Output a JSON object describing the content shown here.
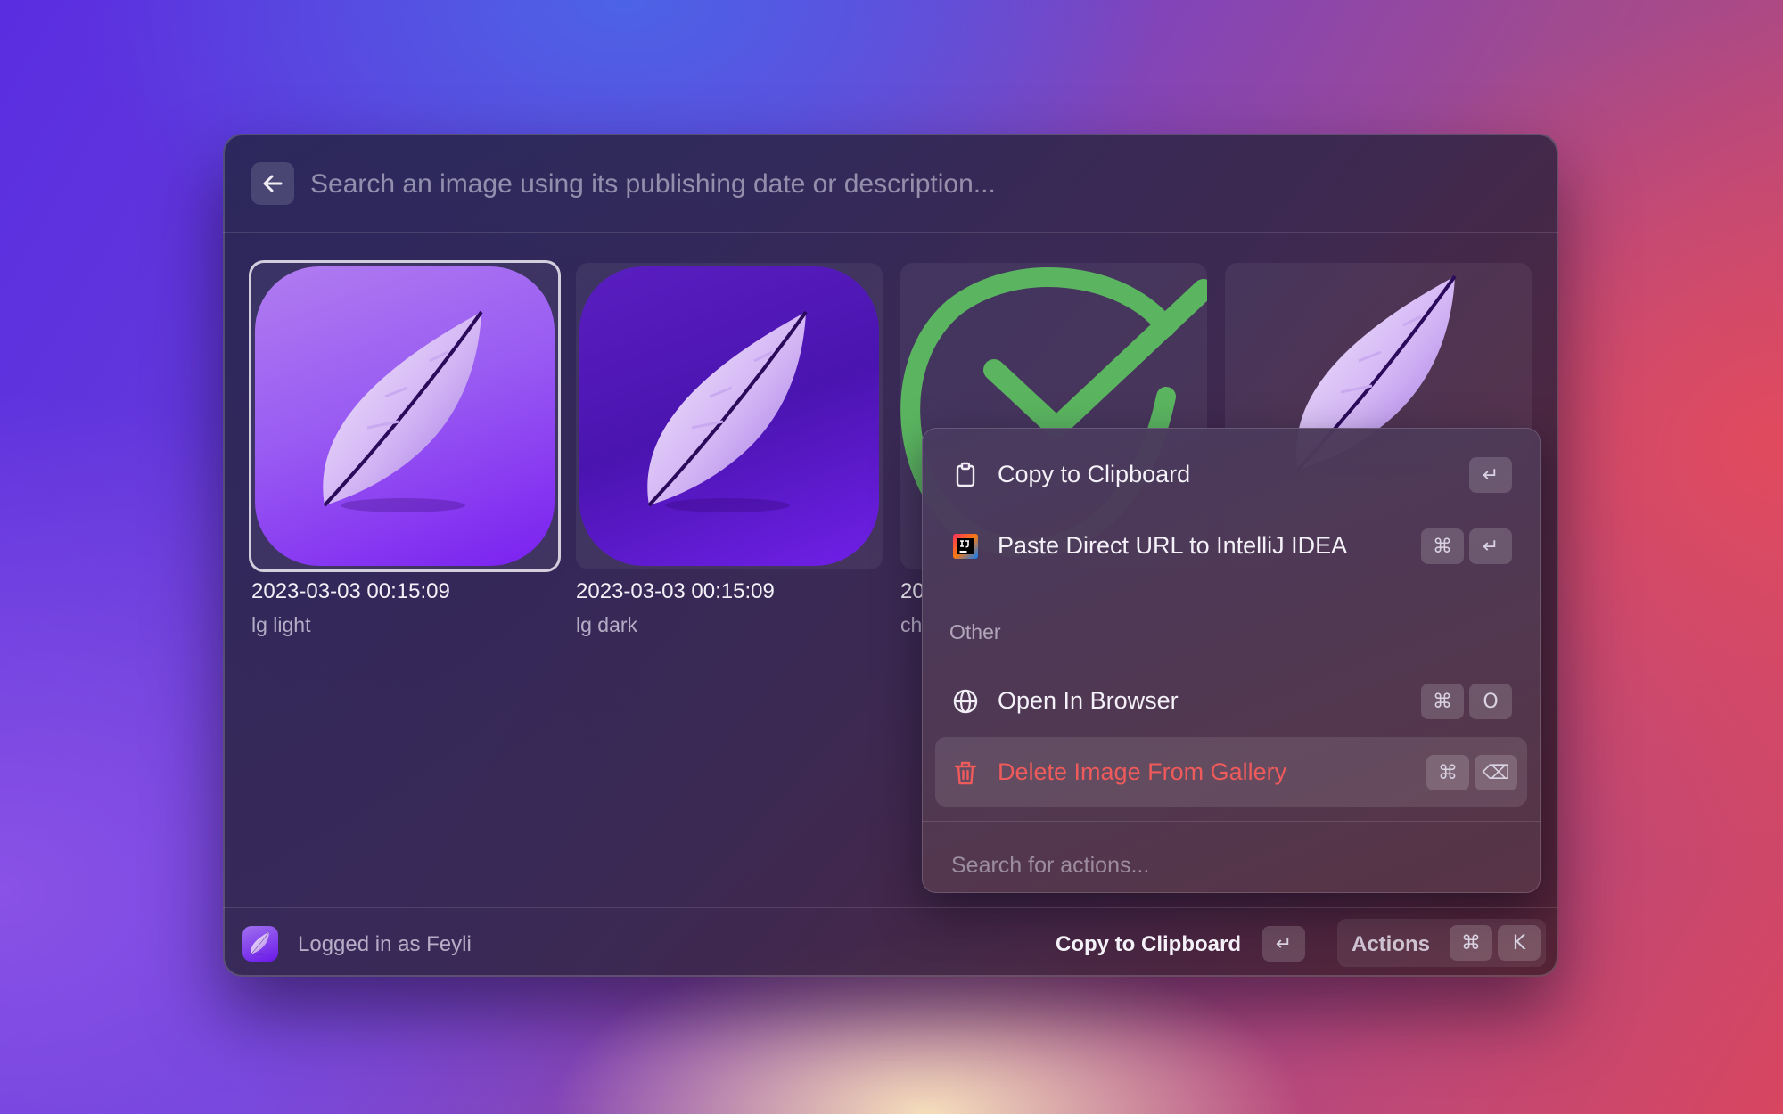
{
  "search": {
    "placeholder": "Search an image using its publishing date or description..."
  },
  "grid": {
    "items": [
      {
        "date": "2023-03-03 00:15:09",
        "description": "lg light",
        "icon": "feather-icon"
      },
      {
        "date": "2023-03-03 00:15:09",
        "description": "lg dark",
        "icon": "feather-icon"
      },
      {
        "date": "20",
        "description": "ch",
        "icon": "checkmark-icon"
      },
      {
        "date": "",
        "description": "",
        "icon": "feather-icon"
      }
    ]
  },
  "action_menu": {
    "items": [
      {
        "label": "Copy to Clipboard",
        "icon": "clipboard-icon",
        "keys": [
          "↵"
        ]
      },
      {
        "label": "Paste Direct URL to IntelliJ IDEA",
        "icon": "intellij-icon",
        "keys": [
          "⌘",
          "↵"
        ]
      }
    ],
    "section_title": "Other",
    "other_items": [
      {
        "label": "Open In Browser",
        "icon": "globe-icon",
        "keys": [
          "⌘",
          "O"
        ]
      },
      {
        "label": "Delete Image From Gallery",
        "icon": "trash-icon",
        "keys": [
          "⌘",
          "⌫"
        ]
      }
    ],
    "search_placeholder": "Search for actions..."
  },
  "footer": {
    "user_label": "Logged in as Feyli",
    "primary_action": "Copy to Clipboard",
    "primary_key": "↵",
    "actions_label": "Actions",
    "actions_keys": [
      "⌘",
      "K"
    ]
  },
  "colors": {
    "danger": "#ef5a5a",
    "check_green": "#5bb560",
    "accent_purple": "#7a20f0"
  }
}
